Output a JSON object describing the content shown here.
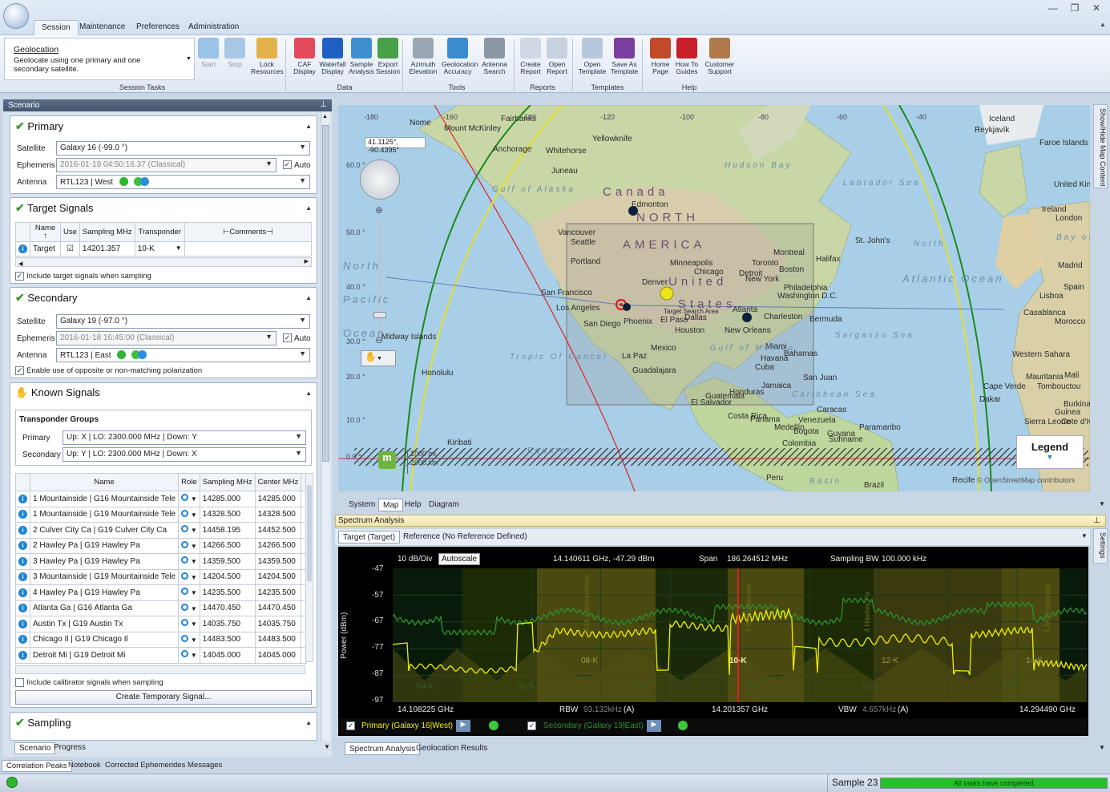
{
  "ribbon": {
    "tabs": [
      "Session",
      "Maintenance",
      "Preferences",
      "Administration"
    ],
    "task_title": "Geolocation",
    "task_desc": "Geolocate using one primary and one secondary satellite.",
    "groups": [
      "Session Tasks",
      "Data",
      "Tools",
      "Reports",
      "Templates",
      "Help"
    ],
    "buttons": [
      {
        "label": "Start",
        "icon": "play-icon"
      },
      {
        "label": "Stop",
        "icon": "stop-icon"
      },
      {
        "label": "Lock Resources",
        "icon": "lock-icon"
      },
      {
        "label": "CAF Display",
        "icon": "caf-icon"
      },
      {
        "label": "Waterfall Display",
        "icon": "waterfall-icon"
      },
      {
        "label": "Sample Analysis",
        "icon": "sample-analysis-icon"
      },
      {
        "label": "Export Session",
        "icon": "export-icon"
      },
      {
        "label": "Azimuth Elevation",
        "icon": "azimuth-icon"
      },
      {
        "label": "Geolocation Accuracy",
        "icon": "globe-icon"
      },
      {
        "label": "Antenna Search",
        "icon": "antenna-icon"
      },
      {
        "label": "Create Report",
        "icon": "create-report-icon"
      },
      {
        "label": "Open Report",
        "icon": "open-report-icon"
      },
      {
        "label": "Open Template",
        "icon": "open-template-icon"
      },
      {
        "label": "Save As Template",
        "icon": "save-icon"
      },
      {
        "label": "Home Page",
        "icon": "books-icon"
      },
      {
        "label": "How To Guides",
        "icon": "book-icon"
      },
      {
        "label": "Customer Support",
        "icon": "support-icon"
      }
    ]
  },
  "scenario": {
    "title": "Scenario",
    "primary": {
      "title": "Primary",
      "satellite_label": "Satellite",
      "satellite": "Galaxy 16 (-99.0 °)",
      "ephemeris_label": "Ephemeris",
      "ephemeris": "2016-01-19 04:50:16.37 (Classical)",
      "auto": "Auto",
      "antenna_label": "Antenna",
      "antenna": "RTL123 | West"
    },
    "target": {
      "title": "Target Signals",
      "headers": [
        "Name",
        "Use",
        "Sampling MHz",
        "Transponder",
        "Comments"
      ],
      "row": {
        "name": "Target",
        "sampling": "14201.357",
        "transponder": "10-K"
      },
      "include": "Include target signals when sampling"
    },
    "secondary": {
      "title": "Secondary",
      "satellite_label": "Satellite",
      "satellite": "Galaxy 19 (-97.0 °)",
      "ephemeris_label": "Ephemeris",
      "ephemeris": "2016-01-18 16:45:00 (Classical)",
      "auto": "Auto",
      "antenna_label": "Antenna",
      "antenna": "RTL123 | East",
      "polar": "Enable use of opposite or non-matching polarization"
    },
    "known": {
      "title": "Known Signals",
      "groups_title": "Transponder Groups",
      "primary_label": "Primary",
      "primary": "Up: X | LO: 2300.000 MHz | Down: Y",
      "secondary_label": "Secondary",
      "secondary": "Up: Y | LO: 2300.000 MHz | Down: X",
      "headers": [
        "Name",
        "Role",
        "Sampling MHz",
        "Center MHz"
      ],
      "rows": [
        {
          "name": "1 Mountainside | G16 Mountainside Tele",
          "sampling": "14285.000",
          "center": "14285.000"
        },
        {
          "name": "1 Mountainside | G19 Mountainside Tele",
          "sampling": "14328.500",
          "center": "14328.500"
        },
        {
          "name": "2 Culver City Ca | G19 Culver City Ca",
          "sampling": "14458.195",
          "center": "14452.500"
        },
        {
          "name": "2 Hawley Pa | G19 Hawley Pa",
          "sampling": "14266.500",
          "center": "14266.500"
        },
        {
          "name": "3 Hawley Pa | G19 Hawley Pa",
          "sampling": "14359.500",
          "center": "14359.500"
        },
        {
          "name": "3 Mountainside | G19 Mountainside Tele",
          "sampling": "14204.500",
          "center": "14204.500"
        },
        {
          "name": "4 Hawley Pa | G19 Hawley Pa",
          "sampling": "14235.500",
          "center": "14235.500"
        },
        {
          "name": "Atlanta Ga | G16 Atlanta Ga",
          "sampling": "14470.450",
          "center": "14470.450"
        },
        {
          "name": "Austin Tx | G19 Austin Tx",
          "sampling": "14035.750",
          "center": "14035.750"
        },
        {
          "name": "Chicago Il | G19 Chicago Il",
          "sampling": "14483.500",
          "center": "14483.500"
        },
        {
          "name": "Detroit Mi | G19 Detroit Mi",
          "sampling": "14045.000",
          "center": "14045.000"
        }
      ],
      "include_cal": "Include calibrator signals when sampling",
      "create_btn": "Create Temporary Signal..."
    },
    "sampling": {
      "title": "Sampling"
    },
    "tabs": [
      "Scenario",
      "Progress"
    ]
  },
  "bottom_tabs": [
    "Correlation Peaks",
    "Notebook",
    "Corrected Ephemerides",
    "Messages"
  ],
  "map": {
    "coord_readout": "41.1125°, -90.4395°",
    "legend": "Legend",
    "attribution": "© OpenStreetMap contributors",
    "scale_1": "1000 mi",
    "scale_2": "2000 km",
    "side_label": "Show/Hide Map Content",
    "lon_labels": [
      "-180",
      "-160",
      "-140",
      "-120",
      "-100",
      "-80",
      "-60",
      "-40"
    ],
    "lat_labels": [
      "60.0 °",
      "50.0 °",
      "40.0 °",
      "30.0 °",
      "20.0 °",
      "10.0 °",
      "0.0 °"
    ],
    "places": [
      {
        "t": "Canada",
        "cls": "big"
      },
      {
        "t": "NORTH",
        "cls": "big"
      },
      {
        "t": "AMERICA",
        "cls": "big"
      },
      {
        "t": "United",
        "cls": "big"
      },
      {
        "t": "States",
        "cls": "big"
      },
      {
        "t": "Chicago"
      },
      {
        "t": "New York"
      },
      {
        "t": "Los Angeles"
      },
      {
        "t": "San Francisco"
      },
      {
        "t": "Mexico"
      },
      {
        "t": "Toronto"
      },
      {
        "t": "Iceland"
      },
      {
        "t": "United Kingdom"
      },
      {
        "t": "Ireland"
      },
      {
        "t": "London"
      },
      {
        "t": "Spain"
      },
      {
        "t": "Madrid"
      },
      {
        "t": "Peru"
      },
      {
        "t": "Brazil"
      },
      {
        "t": "Honolulu"
      },
      {
        "t": "Havana"
      },
      {
        "t": "Bogota"
      },
      {
        "t": "Caracas"
      },
      {
        "t": "Montreal"
      },
      {
        "t": "Houston"
      },
      {
        "t": "Denver"
      },
      {
        "t": "Dallas"
      },
      {
        "t": "Miami"
      },
      {
        "t": "Atlanta"
      },
      {
        "t": "Boston"
      },
      {
        "t": "Anchorage"
      },
      {
        "t": "Vancouver"
      },
      {
        "t": "Edmonton"
      },
      {
        "t": "Reykjavík"
      },
      {
        "t": "Lisboa"
      },
      {
        "t": "Casablanca"
      },
      {
        "t": "Morocco"
      },
      {
        "t": "Mali"
      },
      {
        "t": "Guinea"
      },
      {
        "t": "Kiribati"
      },
      {
        "t": "Midway Islands"
      },
      {
        "t": "Bahamas"
      },
      {
        "t": "Cuba"
      },
      {
        "t": "Jamaica"
      },
      {
        "t": "Honduras"
      },
      {
        "t": "Panama"
      },
      {
        "t": "Costa Rica"
      },
      {
        "t": "Venezuela"
      },
      {
        "t": "Colombia"
      },
      {
        "t": "Guyana"
      },
      {
        "t": "Suriname"
      },
      {
        "t": "Paramaribo"
      },
      {
        "t": "Recife"
      },
      {
        "t": "Medellín"
      },
      {
        "t": "El Salvador"
      },
      {
        "t": "Guatemala"
      },
      {
        "t": "Guadalajara"
      },
      {
        "t": "La Paz"
      },
      {
        "t": "El Paso"
      },
      {
        "t": "San Diego"
      },
      {
        "t": "Phoenix"
      },
      {
        "t": "Portland"
      },
      {
        "t": "Seattle"
      },
      {
        "t": "Minneapolis"
      },
      {
        "t": "Detroit"
      },
      {
        "t": "Philadelphia"
      },
      {
        "t": "Washington D.C."
      },
      {
        "t": "Charleston"
      },
      {
        "t": "New Orleans"
      },
      {
        "t": "Bermuda"
      },
      {
        "t": "St. John's"
      },
      {
        "t": "Halifax"
      },
      {
        "t": "Nome"
      },
      {
        "t": "Mount McKinley"
      },
      {
        "t": "Fairbanks"
      },
      {
        "t": "Whitehorse"
      },
      {
        "t": "Juneau"
      },
      {
        "t": "Yellowknife"
      },
      {
        "t": "Faroe Islands"
      },
      {
        "t": "Western Sahara"
      },
      {
        "t": "Mauritania"
      },
      {
        "t": "Tombouctou"
      },
      {
        "t": "Burkina Faso"
      },
      {
        "t": "Sierra Leone"
      },
      {
        "t": "Cote d'Ivoire"
      },
      {
        "t": "Cape Verde"
      },
      {
        "t": "Dakar"
      },
      {
        "t": "San Juan"
      },
      {
        "t": "Target Search Area"
      }
    ],
    "seas": [
      {
        "t": "North Pacific Ocean"
      },
      {
        "t": "Atlantic Ocean"
      },
      {
        "t": "North"
      },
      {
        "t": "Hudson Bay"
      },
      {
        "t": "Labrador Sea"
      },
      {
        "t": "Gulf of Alaska"
      },
      {
        "t": "Gulf of Mexico"
      },
      {
        "t": "Caribbean Sea"
      },
      {
        "t": "Sargasso Sea"
      },
      {
        "t": "Bay of Biscay"
      },
      {
        "t": "Tropic Of Cancer"
      },
      {
        "t": "Equator"
      },
      {
        "t": "Basin"
      }
    ]
  },
  "map_tabs": [
    "System",
    "Map",
    "Help",
    "Diagram"
  ],
  "spectrum": {
    "panel_title": "Spectrum Analysis",
    "tabs": [
      "Target (Target)",
      "Reference (No Reference Defined)"
    ],
    "scale": "10 dB/Div",
    "autoscale": "Autoscale",
    "cursor": "14.140611 GHz, -47.29 dBm",
    "span_label": "Span",
    "span": "186.264512 MHz",
    "sbw_label": "Sampling BW",
    "sbw": "100.000 kHz",
    "y_axis": "Power (dBm)",
    "y_ticks": [
      "-47",
      "-57",
      "-67",
      "-77",
      "-87",
      "-97"
    ],
    "x_start": "14.108225 GHz",
    "x_center": "14.201357 GHz",
    "x_end": "14.294490 GHz",
    "rbw_label": "RBW",
    "rbw": "93.132kHz",
    "rbw_unit": "(A)",
    "vbw_label": "VBW",
    "vbw": "4.657kHz",
    "vbw_unit": "(A)",
    "primary_legend": "Primary (Galaxy 16|West)",
    "secondary_legend": "Secondary (Galaxy 19|East)",
    "channel_labels_top": [
      "08-K",
      "10-K",
      "12-K",
      "14-K"
    ],
    "channel_labels_bot": [
      "04-K",
      "06-K",
      "08-K",
      "10-K",
      "12-K",
      "16-K"
    ],
    "carrier_labels": [
      "G16 Germantown",
      "3 Mountainside",
      "4 Hawley Pa",
      "1 Mountainside"
    ],
    "colors": {
      "primary": "#f0f000",
      "secondary": "#2f8f2f",
      "marker": "#e02020"
    },
    "bottom_tabs": [
      "Spectrum Analysis",
      "Geolocation Results"
    ]
  },
  "status": {
    "sample": "Sample 23",
    "progress": 1.0,
    "message": "All tasks have completed."
  },
  "side_settings": "Settings"
}
